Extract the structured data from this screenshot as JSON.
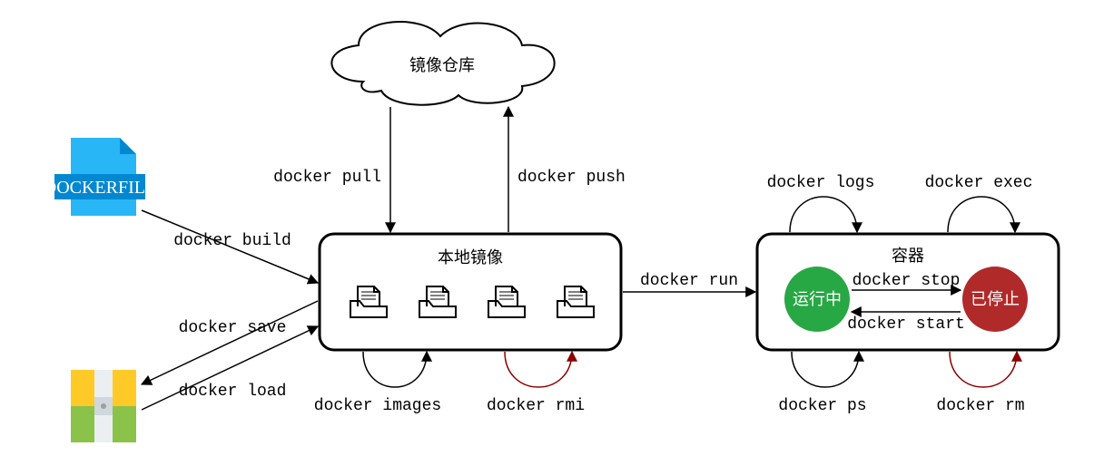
{
  "nodes": {
    "dockerfile_label": "DOCKERFILE",
    "registry_label": "镜像仓库",
    "local_images_label": "本地镜像",
    "containers_label": "容器",
    "running_label": "运行中",
    "stopped_label": "已停止"
  },
  "edges": {
    "pull": "docker pull",
    "push": "docker push",
    "build": "docker build",
    "save": "docker save",
    "load": "docker load",
    "run": "docker run",
    "images": "docker images",
    "rmi": "docker rmi",
    "stop": "docker stop",
    "start": "docker start",
    "logs": "docker logs",
    "exec": "docker exec",
    "ps": "docker ps",
    "rm": "docker rm"
  }
}
